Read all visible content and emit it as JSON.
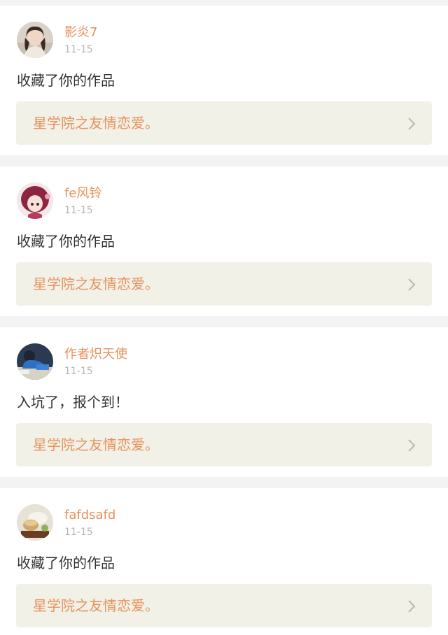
{
  "feed": {
    "items": [
      {
        "username": "影炎7",
        "time": "11-15",
        "message": "收藏了你的作品",
        "work_title": "星学院之友情恋爱。"
      },
      {
        "username": "fe风铃",
        "time": "11-15",
        "message": "收藏了你的作品",
        "work_title": "星学院之友情恋爱。"
      },
      {
        "username": "作者炽天使",
        "time": "11-15",
        "message": "入坑了，报个到！",
        "work_title": "星学院之友情恋爱。"
      },
      {
        "username": "fafdsafd",
        "time": "11-15",
        "message": "收藏了你的作品",
        "work_title": "星学院之友情恋爱。"
      }
    ]
  },
  "colors": {
    "accent": "#e8915b",
    "link_background": "#f1f1e8",
    "timestamp": "#b5b5b5",
    "text": "#333333",
    "page_background": "#f3f3f3"
  },
  "icons": {
    "chevron": "chevron-right-icon"
  }
}
